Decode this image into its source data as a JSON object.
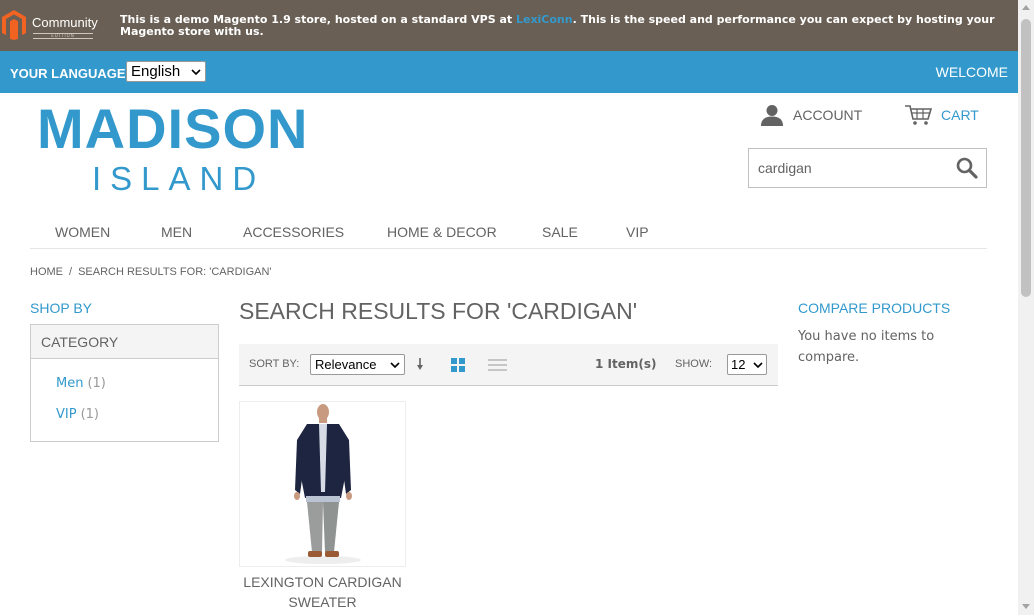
{
  "demo_bar": {
    "brand": "Community",
    "edition": "EDITION",
    "text_before": "This is a demo Magento 1.9 store, hosted on a standard VPS at ",
    "link": "LexiConn",
    "text_after": ". This is the speed and performance you can expect by hosting your Magento store with us."
  },
  "lang_bar": {
    "label": "YOUR LANGUAGE:",
    "selected": "English",
    "welcome": "WELCOME"
  },
  "logo": {
    "top": "MADISON",
    "bottom": "ISLAND"
  },
  "header": {
    "account": "ACCOUNT",
    "cart": "CART"
  },
  "search": {
    "value": "cardigan"
  },
  "nav": [
    "WOMEN",
    "MEN",
    "ACCESSORIES",
    "HOME & DECOR",
    "SALE",
    "VIP"
  ],
  "breadcrumb": {
    "home": "HOME",
    "separator": "/",
    "current": "SEARCH RESULTS FOR: 'CARDIGAN'"
  },
  "sidebar": {
    "shop_by": "SHOP BY",
    "category_title": "CATEGORY",
    "categories": [
      {
        "name": "Men",
        "count": "(1)"
      },
      {
        "name": "VIP",
        "count": "(1)"
      }
    ]
  },
  "main": {
    "title": "SEARCH RESULTS FOR 'CARDIGAN'",
    "sort_label": "SORT BY:",
    "sort_selected": "Relevance",
    "item_count": "1 Item(s)",
    "show_label": "SHOW:",
    "show_selected": "12",
    "product": {
      "name_line1": "LEXINGTON CARDIGAN",
      "name_line2": "SWEATER"
    }
  },
  "compare": {
    "title": "COMPARE PRODUCTS",
    "text": "You have no items to compare."
  },
  "colors": {
    "brand_blue": "#3399cc",
    "demo_bar_bg": "#6a5f54",
    "text": "#636363"
  },
  "icons": [
    "magento-logo-icon",
    "select-caret-icon",
    "account-icon",
    "cart-icon",
    "search-icon",
    "sort-direction-icon",
    "grid-view-icon",
    "list-view-icon"
  ]
}
